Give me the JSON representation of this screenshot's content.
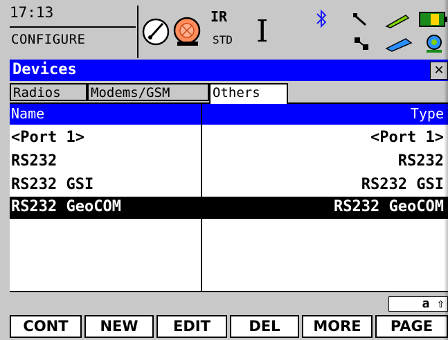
{
  "status": {
    "time": "17:13",
    "mode": "CONFIGURE",
    "edm_top": "IR",
    "edm_bottom": "STD",
    "cursor_glyph": "I",
    "icons": [
      "compass-icon",
      "prism-icon",
      "bluetooth-icon",
      "line-tool-icon",
      "pen-icon",
      "battery-icon",
      "satellite-icon",
      "memory-card-icon",
      "disk-icon"
    ]
  },
  "title": {
    "text": "Devices",
    "close": "✕"
  },
  "tabs": [
    {
      "label": "Radios",
      "active": false
    },
    {
      "label": "Modems/GSM",
      "active": false
    },
    {
      "label": "Others",
      "active": true
    }
  ],
  "list": {
    "headers": {
      "name": "Name",
      "type": "Type"
    },
    "rows": [
      {
        "name": "<Port 1>",
        "type": "<Port 1>",
        "selected": false
      },
      {
        "name": "RS232",
        "type": "RS232",
        "selected": false
      },
      {
        "name": "RS232 GSI",
        "type": "RS232 GSI",
        "selected": false
      },
      {
        "name": "RS232 GeoCOM",
        "type": "RS232 GeoCOM",
        "selected": true
      }
    ]
  },
  "input_mode": "a ⇧",
  "softkeys": [
    "CONT",
    "NEW",
    "EDIT",
    "DEL",
    "MORE",
    "PAGE"
  ],
  "colors": {
    "accent": "#0000ff",
    "panel": "#c8c8c8",
    "selection": "#000000"
  }
}
